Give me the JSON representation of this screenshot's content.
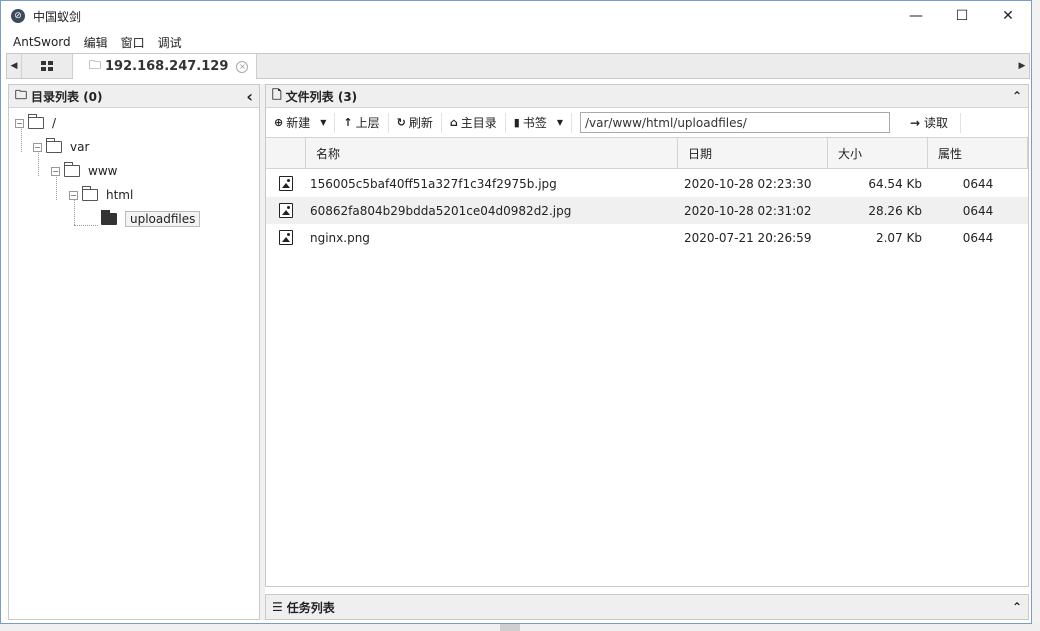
{
  "window": {
    "title": "中国蚁剑",
    "minimize": "—",
    "maximize": "☐",
    "close": "✕"
  },
  "menubar": [
    "AntSword",
    "编辑",
    "窗口",
    "调试"
  ],
  "tabs": {
    "left_arrow": "◀",
    "right_arrow": "▶",
    "active_label": "192.168.247.129",
    "close": "×"
  },
  "left_panel": {
    "title": "目录列表 (0)",
    "collapse": "‹",
    "tree": [
      {
        "label": "/",
        "depth": 0
      },
      {
        "label": "var",
        "depth": 1
      },
      {
        "label": "www",
        "depth": 2
      },
      {
        "label": "html",
        "depth": 3
      },
      {
        "label": "uploadfiles",
        "depth": 4,
        "selected": true
      }
    ]
  },
  "right_panel": {
    "title": "文件列表 (3)",
    "collapse": "⌃",
    "toolbar": {
      "new": "新建",
      "up": "上层",
      "refresh": "刷新",
      "home": "主目录",
      "bookmark": "书签",
      "path": "/var/www/html/uploadfiles/",
      "read": "读取"
    },
    "columns": {
      "name": "名称",
      "date": "日期",
      "size": "大小",
      "attr": "属性"
    },
    "files": [
      {
        "name": "156005c5baf40ff51a327f1c34f2975b.jpg",
        "date": "2020-10-28 02:23:30",
        "size": "64.54 Kb",
        "attr": "0644"
      },
      {
        "name": "60862fa804b29bdda5201ce04d0982d2.jpg",
        "date": "2020-10-28 02:31:02",
        "size": "28.26 Kb",
        "attr": "0644"
      },
      {
        "name": "nginx.png",
        "date": "2020-07-21 20:26:59",
        "size": "2.07 Kb",
        "attr": "0644"
      }
    ]
  },
  "task_panel": {
    "title": "任务列表",
    "expand": "⌃"
  }
}
